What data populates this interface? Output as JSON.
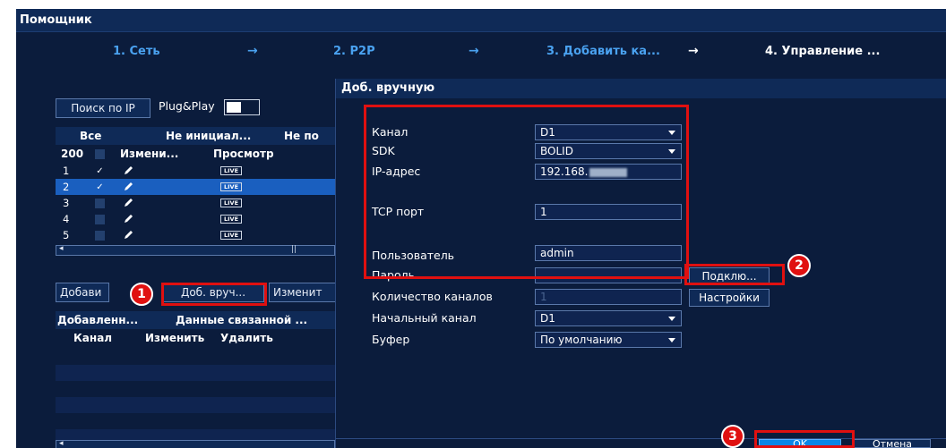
{
  "window": {
    "title": "Помощник"
  },
  "steps": [
    {
      "label": "1. Сеть"
    },
    {
      "label": "2. P2P"
    },
    {
      "label": "3. Добавить ка..."
    },
    {
      "label": "4. Управление ..."
    }
  ],
  "step_arrow": "→",
  "left_panel": {
    "search_button": "Поиск по IP",
    "plug_play_label": "Plug&Play",
    "filter_tabs": [
      "Все",
      "Не инициал...",
      "Не по"
    ],
    "table_header": {
      "count": "200",
      "edit": "Измени...",
      "view": "Просмотр"
    },
    "rows": [
      {
        "num": "1",
        "checked": "✓",
        "live": "LIVE"
      },
      {
        "num": "2",
        "checked": "✓",
        "live": "LIVE"
      },
      {
        "num": "3",
        "checked": "",
        "live": "LIVE"
      },
      {
        "num": "4",
        "checked": "",
        "live": "LIVE"
      },
      {
        "num": "5",
        "checked": "",
        "live": "LIVE"
      }
    ],
    "actions": {
      "add": "Добави",
      "manual_add": "Доб. вруч...",
      "edit": "Изменит"
    },
    "added_tabs": [
      "Добавленн...",
      "Данные связанной ..."
    ],
    "added_header": {
      "channel": "Канал",
      "edit": "Изменить",
      "delete": "Удалить"
    }
  },
  "dialog": {
    "title": "Доб. вручную",
    "fields": {
      "channel": {
        "label": "Канал",
        "value": "D1"
      },
      "sdk": {
        "label": "SDK",
        "value": "BOLID"
      },
      "ip": {
        "label": "IP-адрес",
        "value": "192.168."
      },
      "tcp_port": {
        "label": "TCP порт",
        "value": "1"
      },
      "user": {
        "label": "Пользователь",
        "value": "admin"
      },
      "password": {
        "label": "Пароль",
        "value": ""
      },
      "channel_count": {
        "label": "Количество каналов",
        "value": "1"
      },
      "start_channel": {
        "label": "Начальный канал",
        "value": "D1"
      },
      "buffer": {
        "label": "Буфер",
        "value": "По умолчанию"
      }
    },
    "connect_button": "Подклю...",
    "settings_button": "Настройки",
    "ok_button": "OK",
    "cancel_button": "Отмена"
  },
  "annotations": {
    "badge_1": "1",
    "badge_2": "2",
    "badge_3": "3"
  },
  "colors": {
    "background": "#0b1c3c",
    "header": "#0f2a57",
    "accent": "#0a86e6",
    "selected_row": "#1a5fbf",
    "annotation": "#e01010"
  }
}
